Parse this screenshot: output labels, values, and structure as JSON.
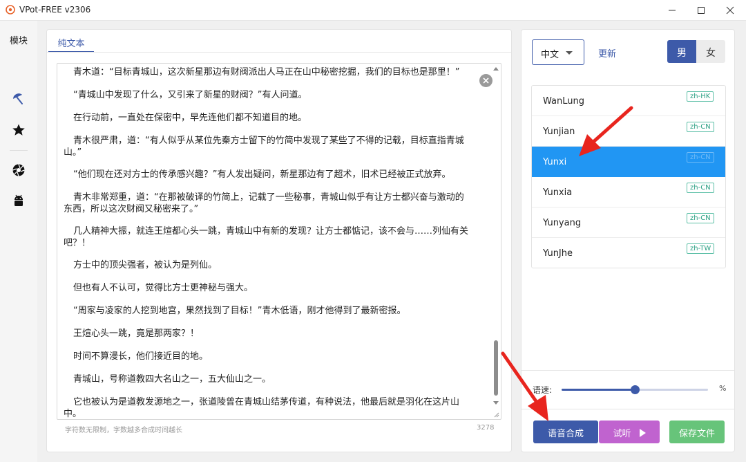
{
  "window": {
    "title": "VPot-FREE v2306",
    "accent_color": "#3d5aa9"
  },
  "sidebar": {
    "title": "模块",
    "icons": [
      "umbrella-icon",
      "star-icon",
      "aperture-icon",
      "android-icon"
    ]
  },
  "editor": {
    "tab_label": "纯文本",
    "paragraphs": [
      "青木道：“目标青城山，这次新星那边有财阀派出人马正在山中秘密挖掘，我们的目标也是那里！”",
      "“青城山中发现了什么，又引来了新星的财阀？”有人问道。",
      "在行动前，一直处在保密中，早先连他们都不知道目的地。",
      "青木很严肃，道：“有人似乎从某位先秦方士留下的竹简中发现了某些了不得的记载，目标直指青城山。”",
      "“他们现在还对方士的传承感兴趣？”有人发出疑问，新星那边有了超术，旧术已经被正式放弃。",
      "青木非常郑重，道：“在那被破译的竹简上，记载了一些秘事，青城山似乎有让方士都兴奋与激动的东西，所以这次财阀又秘密来了。”",
      "几人精神大振，就连王煊都心头一跳，青城山中有新的发现？让方士都惦记，该不会与……列仙有关吧？！",
      "方士中的顶尖强者，被认为是列仙。",
      "但也有人不认可，觉得比方士更神秘与强大。",
      "“周家与凌家的人挖到地宫，果然找到了目标！”青木低语，刚才他得到了最新密报。",
      "王煊心头一跳，竟是那两家？！",
      "时间不算漫长，他们接近目的地。",
      "青城山，号称道教四大名山之一，五大仙山之一。",
      "它也被认为是道教发源地之一，张道陵曾在青城山结茅传道，有种说法，他最后就是羽化在这片山中。"
    ],
    "hint": "字符数无限制，字数越多合成时间越长",
    "char_count": "3278",
    "scroll_fraction": 0.85
  },
  "voice_panel": {
    "language": "中文",
    "refresh_label": "更新",
    "gender_male": "男",
    "gender_female": "女",
    "gender_selected": "男",
    "voices": [
      {
        "name": "WanLung",
        "tag": "zh-HK",
        "selected": false
      },
      {
        "name": "Yunjian",
        "tag": "zh-CN",
        "selected": false
      },
      {
        "name": "Yunxi",
        "tag": "zh-CN",
        "selected": true
      },
      {
        "name": "Yunxia",
        "tag": "zh-CN",
        "selected": false
      },
      {
        "name": "Yunyang",
        "tag": "zh-CN",
        "selected": false
      },
      {
        "name": "YunJhe",
        "tag": "zh-TW",
        "selected": false
      }
    ],
    "speed_label": "语速:",
    "speed_unit": "%",
    "speed_fraction": 0.5,
    "synth_label": "语音合成",
    "listen_label": "试听",
    "save_label": "保存文件",
    "colors": {
      "selected_row": "#2196f3",
      "listen_button": "#c063cf",
      "save_button": "#67c47a",
      "annotation_arrow": "#e8251e"
    }
  }
}
